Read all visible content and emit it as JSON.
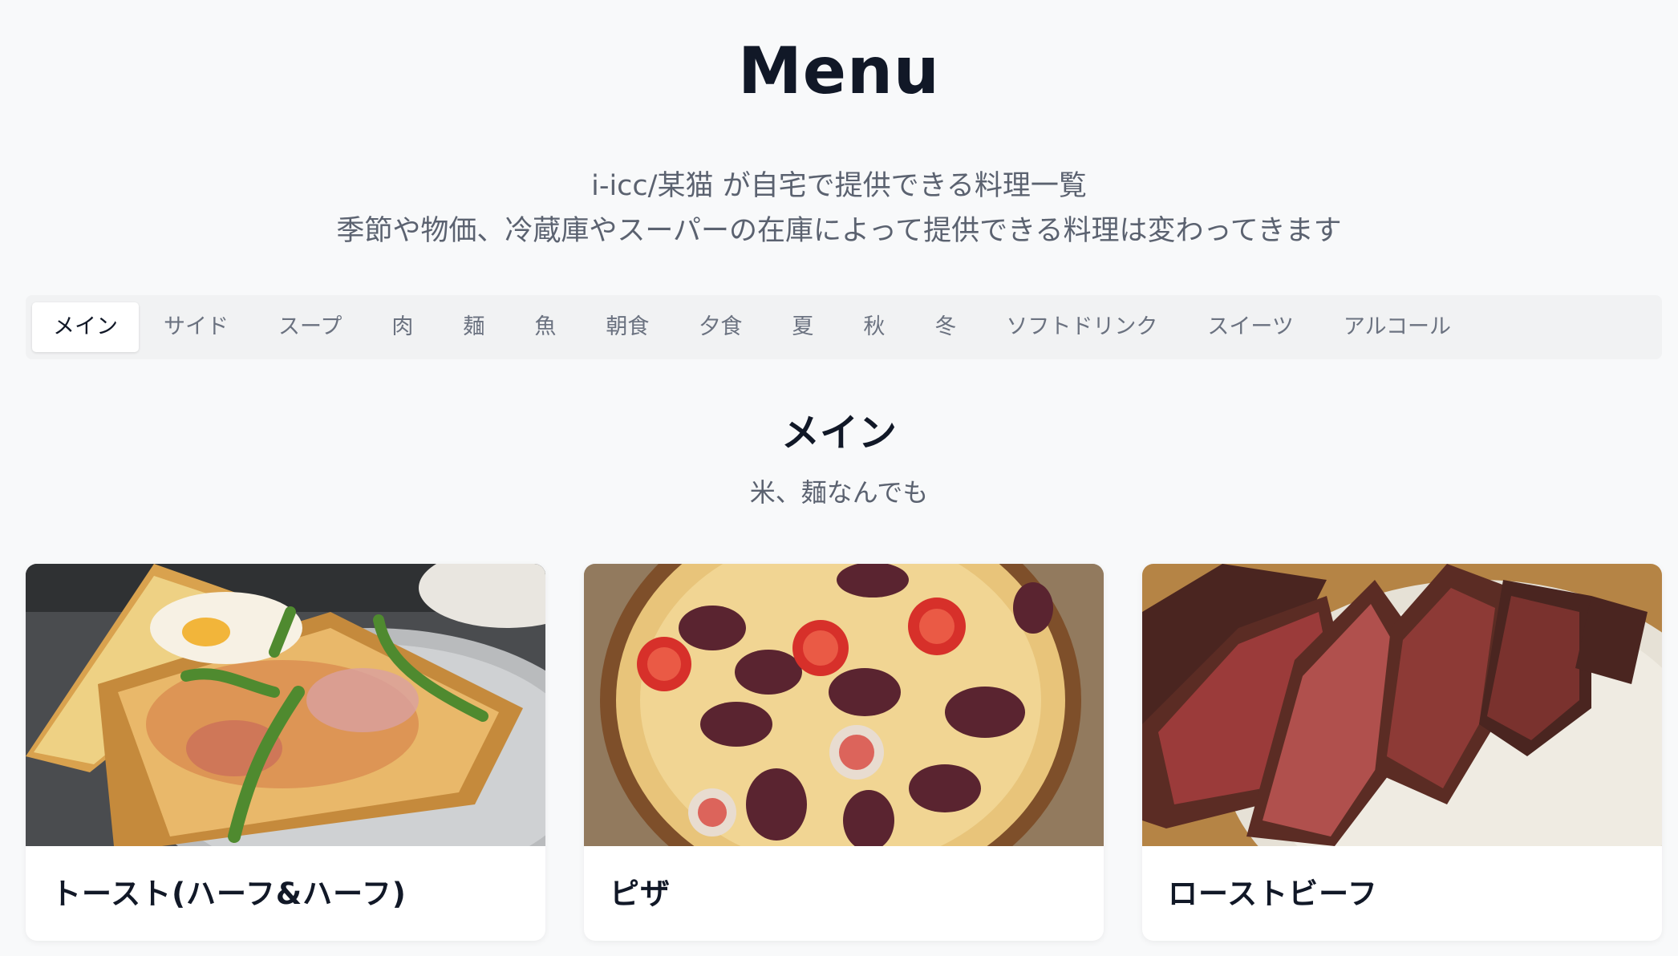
{
  "header": {
    "title": "Menu",
    "description_line1": "i-icc/某猫 が自宅で提供できる料理一覧",
    "description_line2": "季節や物価、冷蔵庫やスーパーの在庫によって提供できる料理は変わってきます"
  },
  "tabs": [
    {
      "label": "メイン",
      "active": true
    },
    {
      "label": "サイド",
      "active": false
    },
    {
      "label": "スープ",
      "active": false
    },
    {
      "label": "肉",
      "active": false
    },
    {
      "label": "麺",
      "active": false
    },
    {
      "label": "魚",
      "active": false
    },
    {
      "label": "朝食",
      "active": false
    },
    {
      "label": "夕食",
      "active": false
    },
    {
      "label": "夏",
      "active": false
    },
    {
      "label": "秋",
      "active": false
    },
    {
      "label": "冬",
      "active": false
    },
    {
      "label": "ソフトドリンク",
      "active": false
    },
    {
      "label": "スイーツ",
      "active": false
    },
    {
      "label": "アルコール",
      "active": false
    }
  ],
  "section": {
    "title": "メイン",
    "subtitle": "米、麺なんでも"
  },
  "cards": [
    {
      "title": "トースト(ハーフ&ハーフ)",
      "image": "toast-photo"
    },
    {
      "title": "ピザ",
      "image": "pizza-photo"
    },
    {
      "title": "ローストビーフ",
      "image": "roast-beef-photo"
    }
  ],
  "colors": {
    "background": "#f8f9fa",
    "tab_bar": "#f1f2f3",
    "card": "#ffffff",
    "text_primary": "#111827",
    "text_muted": "#5b6270"
  }
}
